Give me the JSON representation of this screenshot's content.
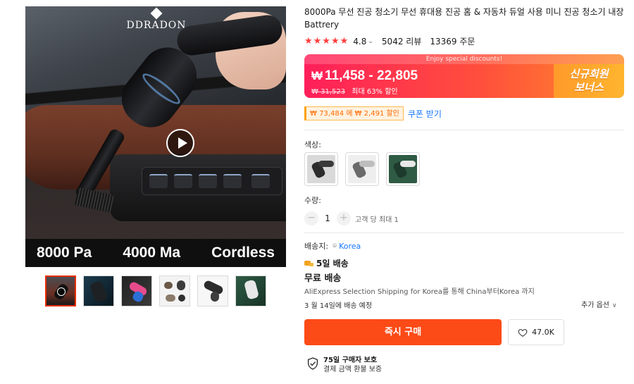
{
  "product": {
    "brand_logo": "DDRADON",
    "specs": [
      "8000 Pa",
      "4000 Ma",
      "Cordless"
    ],
    "title": "8000Pa 무선 진공 청소기 무선 휴대용 진공 홈 & 자동차 듀얼 사용 미니 진공 청소기 내장 Battrery",
    "rating": "4.8",
    "reviews": "5042 리뷰",
    "orders": "13369 주문"
  },
  "thumbnails": [
    {
      "name": "thumb-video"
    },
    {
      "name": "thumb-dark-vacuum"
    },
    {
      "name": "thumb-pink-vacuum"
    },
    {
      "name": "thumb-accessories"
    },
    {
      "name": "thumb-white-vacuum"
    },
    {
      "name": "thumb-green-vacuum"
    }
  ],
  "price": {
    "banner_caption": "Enjoy special discounts!",
    "currency_symbol": "₩",
    "range": "11,458 - 22,805",
    "original": "₩ 31,523",
    "discount": "최대 63% 할인",
    "new_user_bonus": "신규회원 보너스"
  },
  "coupon": {
    "badge": "₩ 73,484 에 ₩ 2,491 할인",
    "link": "쿠폰 받기"
  },
  "color": {
    "label": "색상:",
    "options": [
      "dark-grey",
      "white-grey",
      "green"
    ]
  },
  "quantity": {
    "label": "수량:",
    "value": "1",
    "limit": "고객 당 최대 1"
  },
  "shipping": {
    "label": "배송지:",
    "country": "Korea",
    "delivery": "5일 배송",
    "free": "무료 배송",
    "desc": "AliExpress Selection Shipping for Korea를 통해 China부터Korea 까지",
    "date": "3 월 14일에 배송 예정",
    "more_options": "추가 옵션"
  },
  "actions": {
    "buy_now": "즉시 구매",
    "wishlist_count": "47.0K"
  },
  "protection": {
    "title": "75일 구매자 보호",
    "subtitle": "결제 금액 환불 보증"
  },
  "colors": {
    "accent": "#fc4b17",
    "star": "#ff3d3d",
    "link": "#1677ff"
  }
}
